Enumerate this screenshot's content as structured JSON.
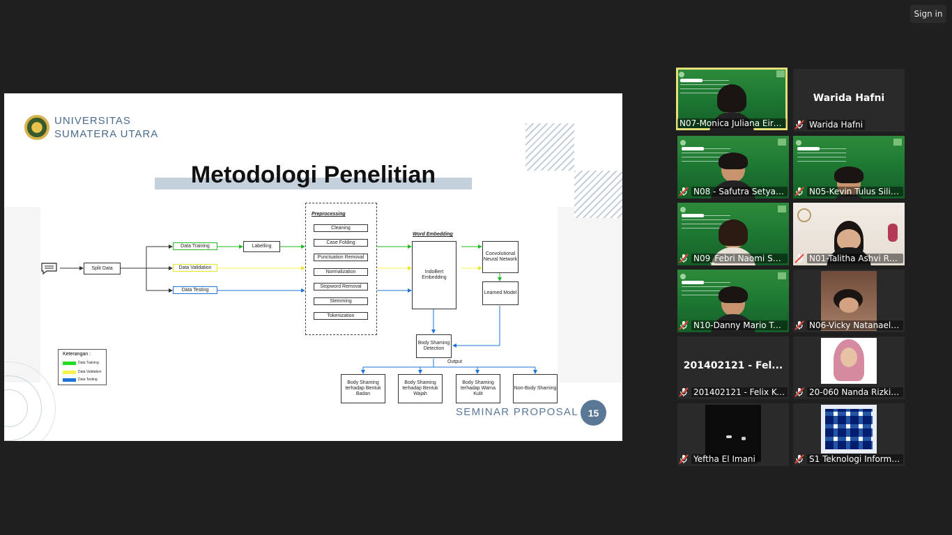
{
  "header": {
    "sign_in_label": "Sign in"
  },
  "slide": {
    "university_line1": "UNIVERSITAS",
    "university_line2": "SUMATERA UTARA",
    "title": "Metodologi Penelitian",
    "footer_label": "SEMINAR PROPOSAL",
    "page_number": "15",
    "diagram": {
      "split_data": "Split Data",
      "data_training": "Data Training",
      "data_validation": "Data Validation",
      "data_testing": "Data Testing",
      "labelling": "Labelling",
      "preprocessing_label": "Preprocessing",
      "preprocessing_steps": [
        "Cleaning",
        "Case Folding",
        "Punctuation Removal",
        "Normalization",
        "Stopword Removal",
        "Stemming",
        "Tokenization"
      ],
      "word_embedding_label": "Word Embedding",
      "indobert": "IndoBert Embedding",
      "cnn": "Convolutional Neural Network",
      "learned_model": "Learned Model",
      "detection": "Body Shaming Detection",
      "output_label": "Output",
      "outputs": [
        "Body Shaming terhadap Bentuk Badan",
        "Body Shaming terhadap Bentuk Wajah",
        "Body Shaming terhadap Warna Kulit",
        "Non-Body Shaming"
      ],
      "legend": {
        "title": "Keterangan :",
        "items": [
          {
            "label": "Data Training",
            "color": "#22dd22"
          },
          {
            "label": "Data Validation",
            "color": "#f4f44a"
          },
          {
            "label": "Data Testing",
            "color": "#1e73d8"
          }
        ]
      }
    }
  },
  "participants": [
    {
      "name": "N07-Monica Juliana Eire...",
      "video": "green",
      "muted": false,
      "speaking": true
    },
    {
      "name": "Warida Hafni",
      "display": "Warida Hafni",
      "video": "none",
      "muted": true
    },
    {
      "name": "N08 - Safutra Setya A...",
      "video": "green",
      "muted": true
    },
    {
      "name": "N05-Kevin Tulus Silito...",
      "video": "green",
      "muted": true
    },
    {
      "name": "N09_Febri Naomi Sof...",
      "video": "green",
      "muted": true
    },
    {
      "name": "N01-Talitha Ashvi Ray...",
      "video": "room",
      "muted": true
    },
    {
      "name": "N10-Danny Mario Tu...",
      "video": "green",
      "muted": true
    },
    {
      "name": "N06-Vicky Natanael S...",
      "video": "photo",
      "muted": true
    },
    {
      "name": "201402121 - Felix Kur...",
      "display": "201402121 - Fel...",
      "video": "none",
      "muted": true
    },
    {
      "name": "20-060 Nanda Rizki A...",
      "video": "photo",
      "muted": true
    },
    {
      "name": "Yeftha El Imani",
      "video": "dark",
      "muted": true
    },
    {
      "name": "S1 Teknologi Informasi",
      "video": "logo",
      "muted": true
    }
  ],
  "colors": {
    "speaker_outline": "#e5e07a",
    "training": "#22dd22",
    "validation": "#f4f44a",
    "testing": "#1e73d8",
    "slide_accent": "#5a7896"
  }
}
